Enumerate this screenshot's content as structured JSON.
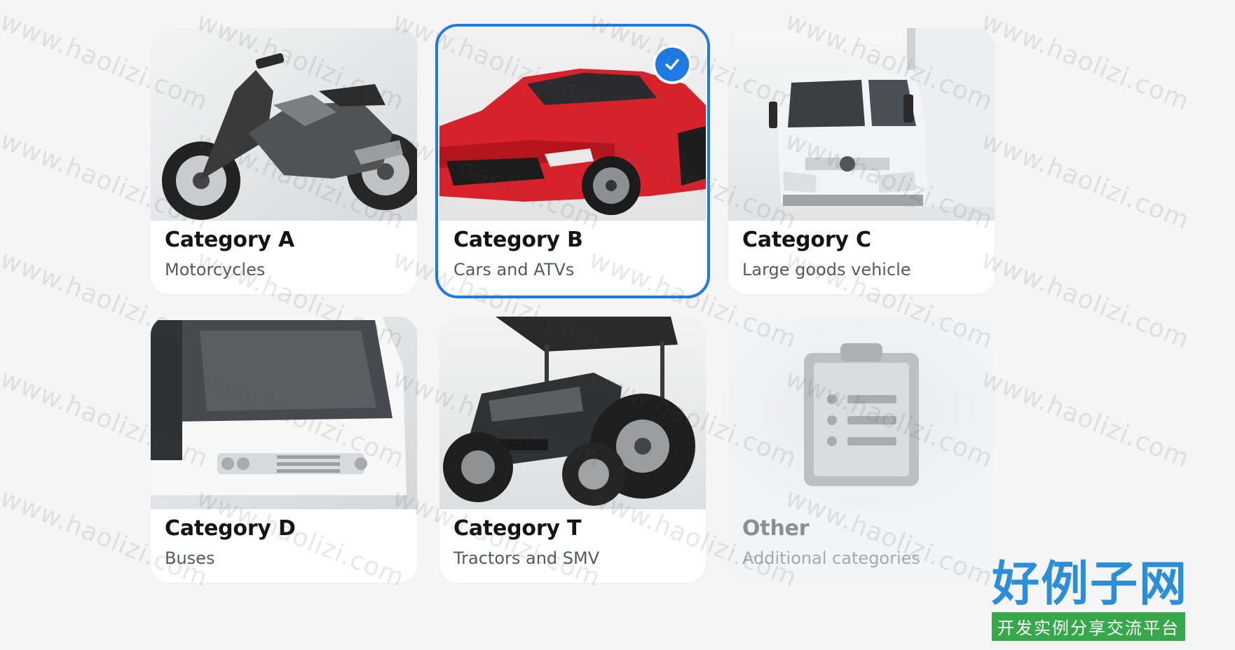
{
  "categories": [
    {
      "id": "A",
      "title": "Category A",
      "subtitle": "Motorcycles",
      "image": "motorcycle-image",
      "selected": false,
      "muted": false
    },
    {
      "id": "B",
      "title": "Category B",
      "subtitle": "Cars and ATVs",
      "image": "red-car-image",
      "selected": true,
      "muted": false
    },
    {
      "id": "C",
      "title": "Category C",
      "subtitle": "Large goods vehicle",
      "image": "truck-image",
      "selected": false,
      "muted": false
    },
    {
      "id": "D",
      "title": "Category D",
      "subtitle": "Buses",
      "image": "bus-image",
      "selected": false,
      "muted": false
    },
    {
      "id": "T",
      "title": "Category T",
      "subtitle": "Tractors and SMV",
      "image": "tractor-image",
      "selected": false,
      "muted": false
    },
    {
      "id": "other",
      "title": "Other",
      "subtitle": "Additional categories",
      "image": "clipboard-icon",
      "selected": false,
      "muted": true
    }
  ],
  "icons": {
    "selected_badge": "check-icon"
  },
  "colors": {
    "accent": "#1e7be6",
    "background": "#f5f5f6",
    "card": "#ffffff",
    "car_red": "#d7222c",
    "watermark_brand_blue": "#2a8fd8",
    "watermark_brand_green": "#37a84a"
  },
  "watermark": {
    "repeated_text": "www.haolizi.com",
    "brand_main": "好例子网",
    "brand_sub": "开发实例分享交流平台"
  }
}
